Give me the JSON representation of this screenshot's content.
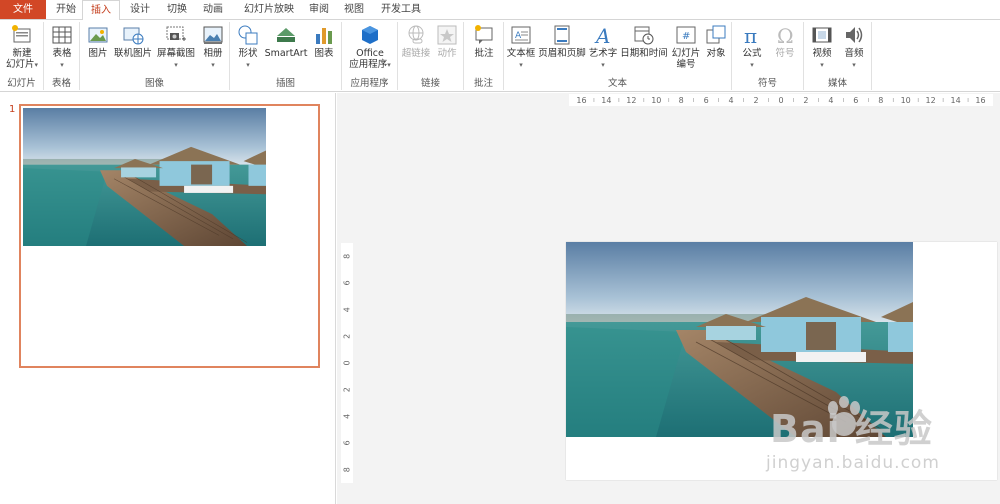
{
  "tabs": [
    {
      "label": "文件",
      "key": "file"
    },
    {
      "label": "开始",
      "key": "home"
    },
    {
      "label": "插入",
      "key": "insert"
    },
    {
      "label": "设计",
      "key": "design"
    },
    {
      "label": "切换",
      "key": "transitions"
    },
    {
      "label": "动画",
      "key": "animations"
    },
    {
      "label": "幻灯片放映",
      "key": "slideshow"
    },
    {
      "label": "审阅",
      "key": "review"
    },
    {
      "label": "视图",
      "key": "view"
    },
    {
      "label": "开发工具",
      "key": "developer"
    }
  ],
  "ribbon": {
    "groups": {
      "slides": "幻灯片",
      "tables": "表格",
      "images": "图像",
      "illustrations": "插图",
      "apps": "应用程序",
      "links": "链接",
      "comments": "批注",
      "text": "文本",
      "symbols": "符号",
      "media": "媒体"
    },
    "buttons": {
      "new_slide_1": "新建",
      "new_slide_2": "幻灯片",
      "table": "表格",
      "picture": "图片",
      "online_picture": "联机图片",
      "screenshot": "屏幕截图",
      "album": "相册",
      "shapes": "形状",
      "smartart": "SmartArt",
      "chart": "图表",
      "office_1": "Office",
      "office_2": "应用程序",
      "hyperlink": "超链接",
      "action": "动作",
      "comment": "批注",
      "textbox": "文本框",
      "header_footer": "页眉和页脚",
      "wordart": "艺术字",
      "datetime": "日期和时间",
      "slide_number_1": "幻灯片",
      "slide_number_2": "编号",
      "object": "对象",
      "equation": "公式",
      "symbol": "符号",
      "video": "视频",
      "audio": "音频"
    }
  },
  "thumbnails": {
    "slide_number": "1"
  },
  "rulers": {
    "horizontal": [
      "16",
      "14",
      "12",
      "10",
      "8",
      "6",
      "4",
      "2",
      "0",
      "2",
      "4",
      "6",
      "8",
      "10",
      "12",
      "14",
      "16"
    ],
    "vertical": [
      "8",
      "6",
      "4",
      "2",
      "0",
      "2",
      "4",
      "6",
      "8"
    ]
  },
  "watermark": {
    "main": "Bai 经验",
    "sub": "jingyan.baidu.com"
  },
  "colors": {
    "accent": "#d24726",
    "active_tab": "#c43e1c",
    "thumb_border": "#e0845e"
  }
}
